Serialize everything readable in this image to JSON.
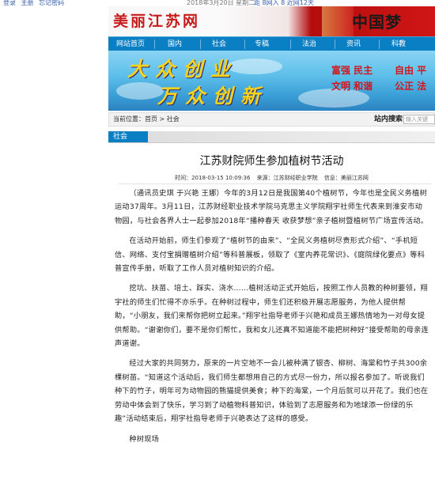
{
  "topbar": {
    "login": "登录",
    "home": "主册",
    "forgot": "忘记密码",
    "date": "2018年3月20日 星期二",
    "stats": "距 8网入 8 近网12天"
  },
  "banner": {
    "logo": "美丽江苏网",
    "dream": "中国梦"
  },
  "nav": [
    "网站首页",
    "国内",
    "社会",
    "专稿",
    "法治",
    "资讯",
    "科教"
  ],
  "hero": {
    "line1": "大众创业",
    "line2": "万众创新",
    "slogans": [
      "富强 民主",
      "自由 平",
      "文明 和谐",
      "公正 法"
    ]
  },
  "breadcrumb": {
    "prefix": "当前位置：",
    "home": "首页",
    "sep": ">",
    "current": "社会"
  },
  "search": {
    "label": "站内搜索",
    "placeholder": "输入关键"
  },
  "section": {
    "tab": "社会"
  },
  "article": {
    "title": "江苏财院师生参加植树节活动",
    "time": "时间：2018-03-15 10:09:36",
    "source": "来源：江苏财经职业学院",
    "info": "信息：美丽江苏网",
    "paragraphs": [
      "（通讯员史琪 于兴艳 王娜）今年的3月12日是我国第40个植树节，今年也是全民义务植树运动37周年。3月11日，江苏财经职业技术学院马克思主义学院翔宇社师生代表来到淮安市动物园，与社会各界人士一起参加2018年“播种春天 收获梦想”亲子植树暨植树节广场宣传活动。",
      "在活动开始前，师生们参观了“植树节的由来”、“全民义务植树尽责形式介绍”、“手机短信、网络、支付宝捐赠植树介绍”等科普展板，领取了《室内养花常识》、《庭院绿化要点》等科普宣传手册，听取了工作人员对植树知识的介绍。",
      "挖坑、扶苗、培土、踩实、浇水……植树活动正式开始后，按照工作人员教的种树要领，翔宇社的师生们忙得不亦乐乎。在种树过程中，师生们还积极开展志愿服务，为他人提供帮助，“小朋友，我们来帮你把树立起来。”翔宇社指导老师于兴艳和成员王娜热情地为一对母女提供帮助。“谢谢你们，要不是你们帮忙，我和女儿还真不知道能不能把树种好”接受帮助的母亲连声道谢。",
      "经过大家的共同努力，原来的一片空地不一会儿被种满了银杏、柳树、海棠和竹子共300余棵树苗。“知道这个活动后，我们师生都想用自己的方式尽一份力，所以报名参加了。听说我们种下的竹子，明年可为动物园的熊猫提供美食；种下的海棠，一个月后就可以开花了。我们也在劳动中体会到了快乐，学习到了动植物科普知识，体验到了志愿服务和为地球添一份绿的乐趣”活动结束后，翔宇社指导老师于兴艳表达了这样的感受。",
      "种树现场"
    ]
  },
  "colors": {
    "nav_blue": "#0b7fc3",
    "logo_red": "#c71a1a",
    "slogan_red": "#d4161c",
    "hero_yellow": "#f8d21a"
  }
}
